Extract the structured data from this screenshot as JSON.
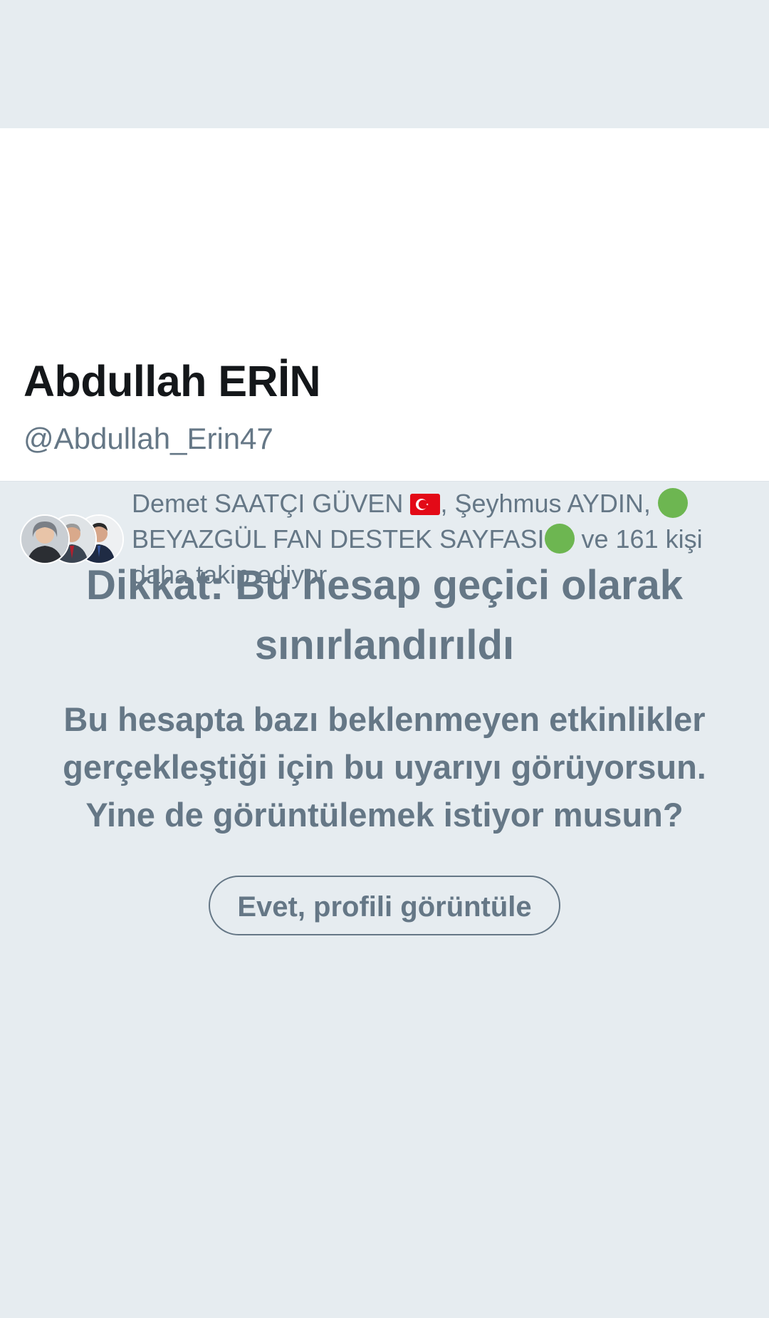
{
  "profile": {
    "display_name": "Abdullah ERİN",
    "handle": "@Abdullah_Erin47"
  },
  "followers": {
    "name_1": "Demet SAATÇI GÜVEN",
    "separator_1": ", ",
    "name_2": "Şeyhmus AYDIN,",
    "name_3": "BEYAZGÜL FAN DESTEK SAYFASI",
    "suffix": " ve 161 kişi daha takip ediyor"
  },
  "warning": {
    "title": "Dikkat: Bu hesap geçici olarak sınırlandırıldı",
    "description": "Bu hesapta bazı beklenmeyen etkinlikler gerçekleştiği için bu uyarıyı görüyorsun. Yine de görüntülemek istiyor musun?",
    "button_label": "Evet, profili görüntüle"
  },
  "colors": {
    "background": "#e6ecf0",
    "card": "#ffffff",
    "text_primary": "#14171a",
    "text_secondary": "#657786",
    "green_dot": "#6db651",
    "flag_red": "#e30a17"
  },
  "icons": {
    "flag": "turkey-flag-icon",
    "dot": "green-circle-icon"
  }
}
